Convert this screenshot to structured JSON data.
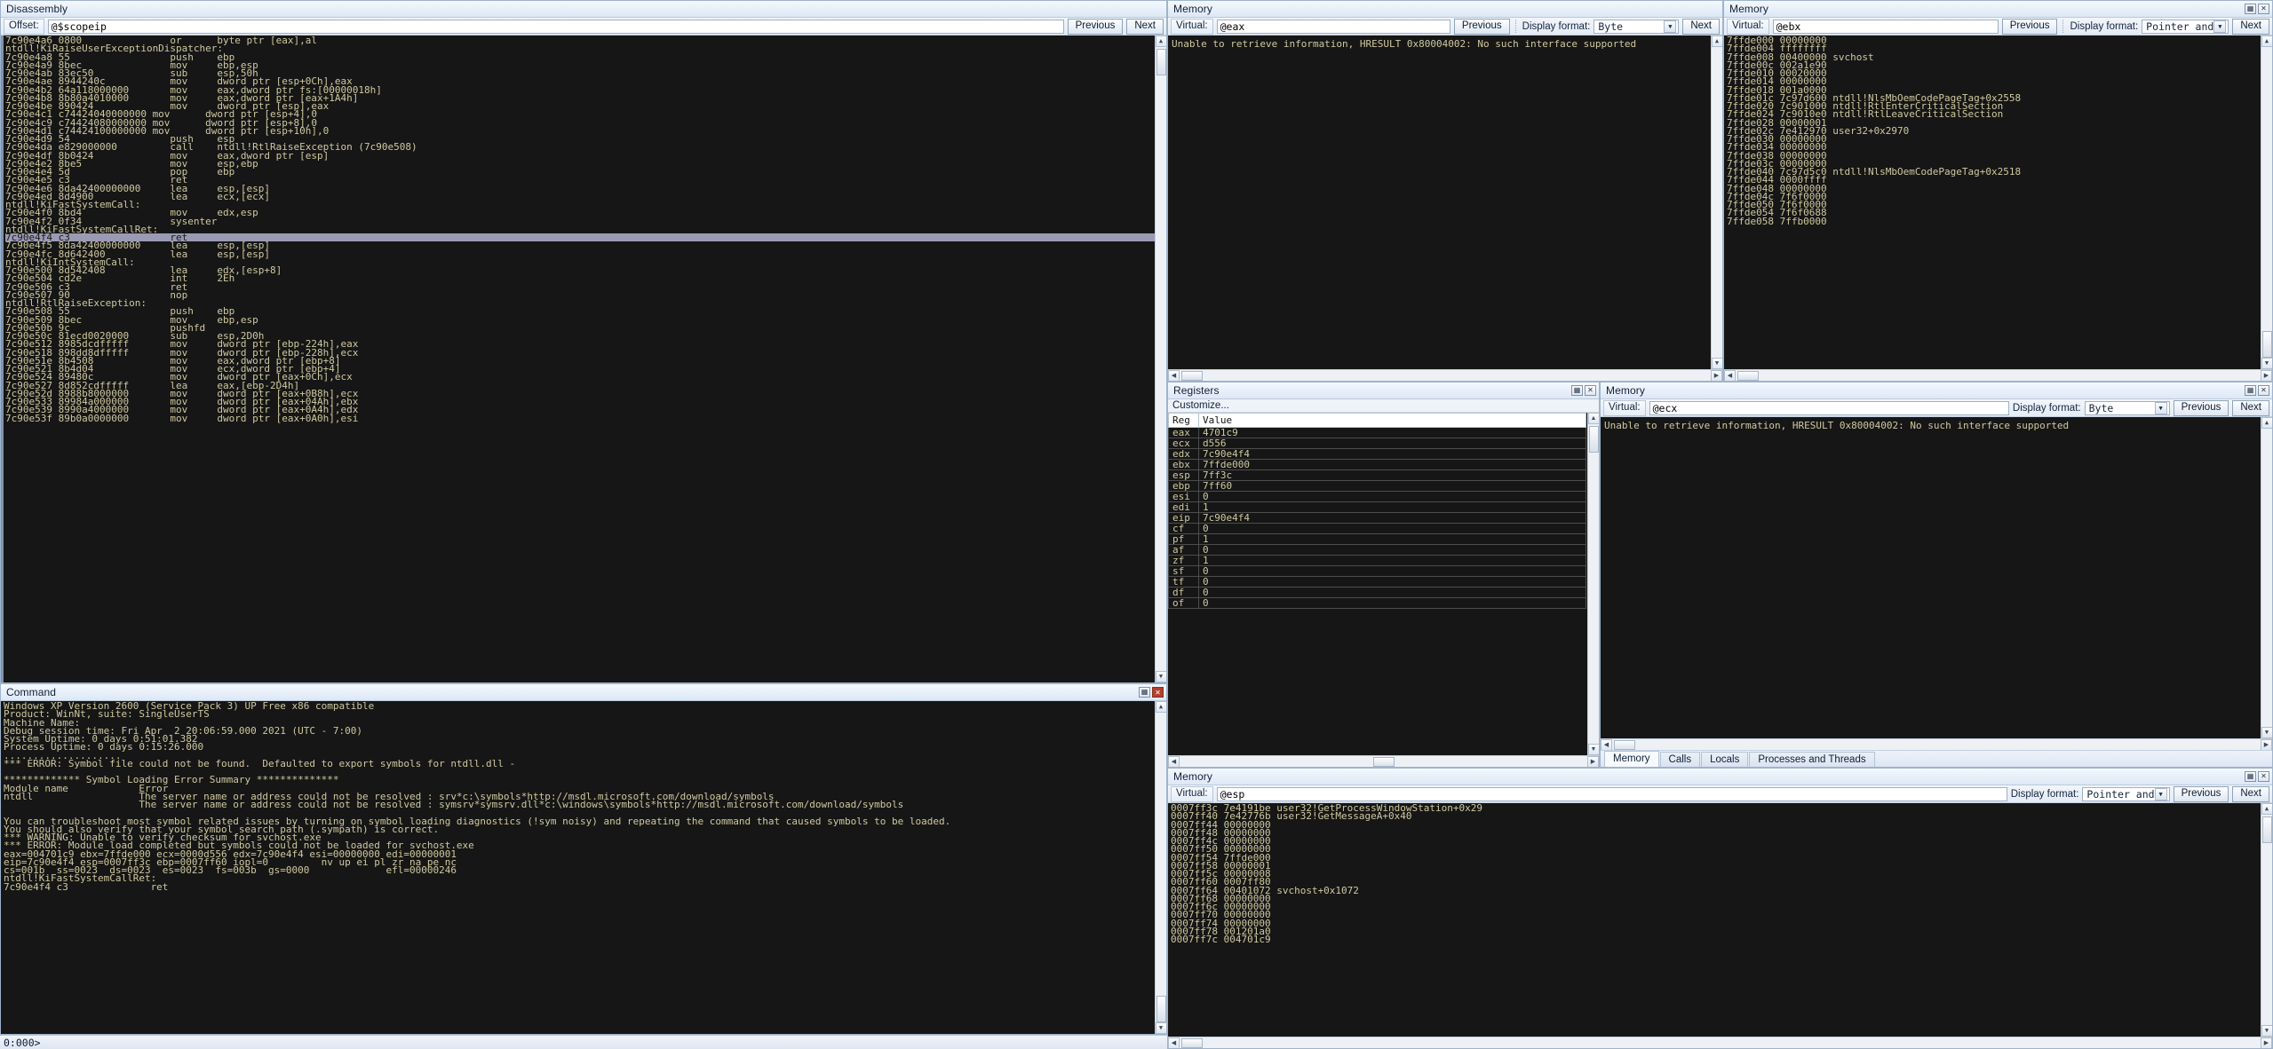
{
  "disassembly": {
    "title": "Disassembly",
    "offset_label": "Offset:",
    "offset_value": "@$scopeip",
    "previous_label": "Previous",
    "next_label": "Next",
    "lines": [
      "7c90e4a6 0800               or      byte ptr [eax],al",
      "ntdll!KiRaiseUserExceptionDispatcher:",
      "7c90e4a8 55                 push    ebp",
      "7c90e4a9 8bec               mov     ebp,esp",
      "7c90e4ab 83ec50             sub     esp,50h",
      "7c90e4ae 8944240c           mov     dword ptr [esp+0Ch],eax",
      "7c90e4b2 64a118000000       mov     eax,dword ptr fs:[00000018h]",
      "7c90e4b8 8b80a4010000       mov     eax,dword ptr [eax+1A4h]",
      "7c90e4be 890424             mov     dword ptr [esp],eax",
      "7c90e4c1 c74424040000000 mov      dword ptr [esp+4],0",
      "7c90e4c9 c74424080000000 mov      dword ptr [esp+8],0",
      "7c90e4d1 c74424100000000 mov      dword ptr [esp+10h],0",
      "7c90e4d9 54                 push    esp",
      "7c90e4da e829000000         call    ntdll!RtlRaiseException (7c90e508)",
      "7c90e4df 8b0424             mov     eax,dword ptr [esp]",
      "7c90e4e2 8be5               mov     esp,ebp",
      "7c90e4e4 5d                 pop     ebp",
      "7c90e4e5 c3                 ret",
      "7c90e4e6 8da42400000000     lea     esp,[esp]",
      "7c90e4ed 8d4900             lea     ecx,[ecx]",
      "ntdll!KiFastSystemCall:",
      "7c90e4f0 8bd4               mov     edx,esp",
      "7c90e4f2 0f34               sysenter",
      "ntdll!KiFastSystemCallRet:",
      "7c90e4f4 c3                 ret",
      "7c90e4f5 8da42400000000     lea     esp,[esp]",
      "7c90e4fc 8d642400           lea     esp,[esp]",
      "ntdll!KiIntSystemCall:",
      "7c90e500 8d542408           lea     edx,[esp+8]",
      "7c90e504 cd2e               int     2Eh",
      "7c90e506 c3                 ret",
      "7c90e507 90                 nop",
      "ntdll!RtlRaiseException:",
      "7c90e508 55                 push    ebp",
      "7c90e509 8bec               mov     ebp,esp",
      "7c90e50b 9c                 pushfd",
      "7c90e50c 81ecd0020000       sub     esp,2D0h",
      "7c90e512 8985dcdfffff       mov     dword ptr [ebp-224h],eax",
      "7c90e518 898dd8dfffff       mov     dword ptr [ebp-228h],ecx",
      "7c90e51e 8b4508             mov     eax,dword ptr [ebp+8]",
      "7c90e521 8b4d04             mov     ecx,dword ptr [ebp+4]",
      "7c90e524 89480c             mov     dword ptr [eax+0Ch],ecx",
      "7c90e527 8d852cdfffff       lea     eax,[ebp-2D4h]",
      "7c90e52d 8988b8000000       mov     dword ptr [eax+0B8h],ecx",
      "7c90e533 89984a000000       mov     dword ptr [eax+04Ah],ebx",
      "7c90e539 8990a4000000       mov     dword ptr [eax+0A4h],edx",
      "7c90e53f 89b0a0000000       mov     dword ptr [eax+0A0h],esi"
    ],
    "highlight_index": 24
  },
  "memory_eax": {
    "title": "Memory",
    "virtual_label": "Virtual:",
    "virtual_value": "@eax",
    "previous_label": "Previous",
    "next_label": "Next",
    "format_label": "Display format:",
    "format_value": "Byte",
    "message": "Unable to retrieve information, HRESULT 0x80004002: No such interface supported"
  },
  "memory_ebx": {
    "title": "Memory",
    "virtual_label": "Virtual:",
    "virtual_value": "@ebx",
    "previous_label": "Previous",
    "next_label": "Next",
    "format_label": "Display format:",
    "format_value": "Pointer and",
    "lines": [
      "7ffde000 00000000",
      "7ffde004 ffffffff",
      "7ffde008 00400000 svchost",
      "7ffde00c 002a1e90",
      "7ffde010 00020000",
      "7ffde014 00000000",
      "7ffde018 001a0000",
      "7ffde01c 7c97d600 ntdll!NlsMbOemCodePageTag+0x2558",
      "7ffde020 7c901000 ntdll!RtlEnterCriticalSection",
      "7ffde024 7c9010e0 ntdll!RtlLeaveCriticalSection",
      "7ffde028 00000001",
      "7ffde02c 7e412970 user32+0x2970",
      "7ffde030 00000000",
      "7ffde034 00000000",
      "7ffde038 00000000",
      "7ffde03c 00000000",
      "7ffde040 7c97d5c0 ntdll!NlsMbOemCodePageTag+0x2518",
      "7ffde044 0000ffff",
      "7ffde048 00000000",
      "7ffde04c 7f6f0000",
      "7ffde050 7f6f0000",
      "7ffde054 7f6f0688",
      "7ffde058 7ffb0000"
    ]
  },
  "memory_ecx": {
    "title": "Memory",
    "virtual_label": "Virtual:",
    "virtual_value": "@ecx",
    "previous_label": "Previous",
    "next_label": "Next",
    "format_label": "Display format:",
    "format_value": "Byte",
    "message": "Unable to retrieve information, HRESULT 0x80004002: No such interface supported",
    "tabs": [
      {
        "label": "Memory",
        "active": true
      },
      {
        "label": "Calls",
        "active": false
      },
      {
        "label": "Locals",
        "active": false
      },
      {
        "label": "Processes and Threads",
        "active": false
      }
    ]
  },
  "memory_esp": {
    "title": "Memory",
    "virtual_label": "Virtual:",
    "virtual_value": "@esp",
    "previous_label": "Previous",
    "next_label": "Next",
    "format_label": "Display format:",
    "format_value": "Pointer and",
    "lines": [
      "0007ff3c 7e4191be user32!GetProcessWindowStation+0x29",
      "0007ff40 7e42776b user32!GetMessageA+0x40",
      "0007ff44 00000000",
      "0007ff48 00000000",
      "0007ff4c 00000000",
      "0007ff50 00000000",
      "0007ff54 7ffde000",
      "0007ff58 00000001",
      "0007ff5c 00000008",
      "0007ff60 0007ff80",
      "0007ff64 00401072 svchost+0x1072",
      "0007ff68 00000000",
      "0007ff6c 00000000",
      "0007ff70 00000000",
      "0007ff74 00000000",
      "0007ff78 001201a0",
      "0007ff7c 004701c9"
    ]
  },
  "registers": {
    "title": "Registers",
    "customize_label": "Customize...",
    "columns": [
      "Reg",
      "Value"
    ],
    "rows": [
      {
        "reg": "eax",
        "value": "4701c9"
      },
      {
        "reg": "ecx",
        "value": "d556"
      },
      {
        "reg": "edx",
        "value": "7c90e4f4"
      },
      {
        "reg": "ebx",
        "value": "7ffde000"
      },
      {
        "reg": "esp",
        "value": "7ff3c"
      },
      {
        "reg": "ebp",
        "value": "7ff60"
      },
      {
        "reg": "esi",
        "value": "0"
      },
      {
        "reg": "edi",
        "value": "1"
      },
      {
        "reg": "eip",
        "value": "7c90e4f4"
      },
      {
        "reg": "cf",
        "value": "0"
      },
      {
        "reg": "pf",
        "value": "1"
      },
      {
        "reg": "af",
        "value": "0"
      },
      {
        "reg": "zf",
        "value": "1"
      },
      {
        "reg": "sf",
        "value": "0"
      },
      {
        "reg": "tf",
        "value": "0"
      },
      {
        "reg": "df",
        "value": "0"
      },
      {
        "reg": "of",
        "value": "0"
      }
    ]
  },
  "command": {
    "title": "Command",
    "lines": [
      "Windows XP Version 2600 (Service Pack 3) UP Free x86 compatible",
      "Product: WinNt, suite: SingleUserTS",
      "Machine Name:",
      "Debug session time: Fri Apr  2 20:06:59.000 2021 (UTC - 7:00)",
      "System Uptime: 0 days 0:51:01.382",
      "Process Uptime: 0 days 0:15:26.000",
      "....................",
      "*** ERROR: Symbol file could not be found.  Defaulted to export symbols for ntdll.dll - ",
      "",
      "************* Symbol Loading Error Summary **************",
      "Module name            Error",
      "ntdll                  The server name or address could not be resolved : srv*c:\\symbols*http://msdl.microsoft.com/download/symbols",
      "                       The server name or address could not be resolved : symsrv*symsrv.dll*c:\\windows\\symbols*http://msdl.microsoft.com/download/symbols",
      "",
      "You can troubleshoot most symbol related issues by turning on symbol loading diagnostics (!sym noisy) and repeating the command that caused symbols to be loaded.",
      "You should also verify that your symbol search path (.sympath) is correct.",
      "*** WARNING: Unable to verify checksum for svchost.exe",
      "*** ERROR: Module load completed but symbols could not be loaded for svchost.exe",
      "eax=004701c9 ebx=7ffde000 ecx=0000d556 edx=7c90e4f4 esi=00000000 edi=00000001",
      "eip=7c90e4f4 esp=0007ff3c ebp=0007ff60 iopl=0         nv up ei pl zr na pe nc",
      "cs=001b  ss=0023  ds=0023  es=0023  fs=003b  gs=0000             efl=00000246",
      "ntdll!KiFastSystemCallRet:",
      "7c90e4f4 c3              ret"
    ]
  },
  "statusbar": {
    "text": "0:000>"
  },
  "icons": {
    "dock": "dock-icon",
    "close": "close-icon",
    "caret_down": "▼",
    "scroll_up": "▲",
    "scroll_down": "▼",
    "scroll_left": "◀",
    "scroll_right": "▶"
  }
}
